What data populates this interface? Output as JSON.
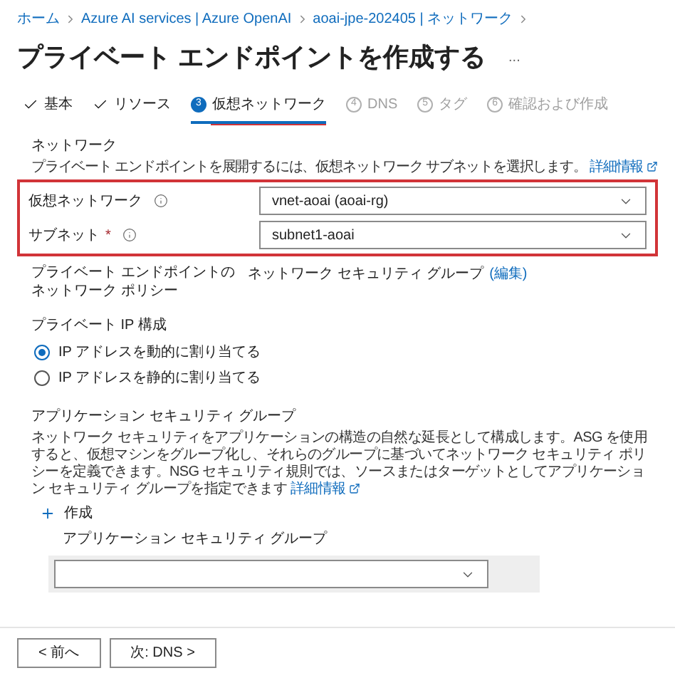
{
  "breadcrumb": [
    {
      "label": "ホーム"
    },
    {
      "label": "Azure AI services | Azure OpenAI"
    },
    {
      "label": "aoai-jpe-202405 | ネットワーク"
    }
  ],
  "title": "プライベート エンドポイントを作成する",
  "more": "...",
  "tabs": [
    {
      "label": "基本",
      "kind": "done",
      "selected": false
    },
    {
      "label": "リソース",
      "kind": "done",
      "selected": false
    },
    {
      "label": "仮想ネットワーク",
      "kind": "step",
      "step": "3",
      "selected": true
    },
    {
      "label": "DNS",
      "kind": "step",
      "step": "4",
      "selected": false
    },
    {
      "label": "タグ",
      "kind": "step",
      "step": "5",
      "selected": false
    },
    {
      "label": "確認および作成",
      "kind": "step",
      "step": "6",
      "selected": false
    }
  ],
  "network": {
    "heading": "ネットワーク",
    "description": "プライベート エンドポイントを展開するには、仮想ネットワーク サブネットを選択します。",
    "link": "詳細情報",
    "highlighted": true,
    "fields": [
      {
        "label": "仮想ネットワーク",
        "value": "vnet-aoai (aoai-rg)"
      },
      {
        "label": "サブネット",
        "required_mark": "*",
        "value": "subnet1-aoai"
      }
    ]
  },
  "policy": {
    "label": "プライベート エンドポイントのネットワーク ポリシー",
    "value": "ネットワーク セキュリティ グループ",
    "link": "(編集)"
  },
  "ip": {
    "heading": "プライベート IP 構成",
    "options": [
      {
        "label": "IP アドレスを動的に割り当てる",
        "selected": true
      },
      {
        "label": "IP アドレスを静的に割り当てる",
        "selected": false
      }
    ]
  },
  "asg": {
    "heading": "アプリケーション セキュリティ グループ",
    "description": "ネットワーク セキュリティをアプリケーションの構造の自然な延長として構成します。ASG を使用すると、仮想マシンをグループ化し、それらのグループに基づいてネットワーク セキュリティ ポリシーを定義できます。NSG セキュリティ規則では、ソースまたはターゲットとしてアプリケーション セキュリティ グループを指定できます",
    "link": "詳細情報",
    "create": "作成",
    "field_label": "アプリケーション セキュリティ グループ"
  },
  "footer": {
    "buttons": [
      {
        "label": "< 前へ"
      },
      {
        "label": "次: DNS >"
      }
    ]
  }
}
